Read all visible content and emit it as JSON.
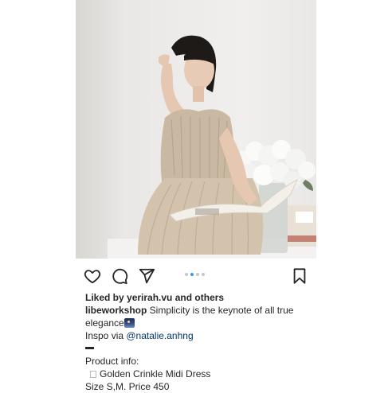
{
  "post": {
    "image_alt": "",
    "carousel": {
      "count": 4,
      "active_index": 1
    }
  },
  "actions": {
    "like_icon": "heart-icon",
    "comment_icon": "comment-icon",
    "share_icon": "send-icon",
    "save_icon": "bookmark-icon"
  },
  "likes": {
    "prefix": "Liked by ",
    "user": "yerirah.vu",
    "joiner": " and ",
    "others": "others"
  },
  "caption": {
    "username": "libeworkshop",
    "text_line1": " Simplicity is the keynote of all true",
    "text_line2": "elegance",
    "inspo_prefix": "Inspo via ",
    "inspo_mention": "@natalie.anhng",
    "product_info": "Product info:",
    "product_name": "Golden Crinkle Midi Dress",
    "size_price": "Size S,M. Price 450"
  },
  "colors": {
    "text": "#262626",
    "mention": "#00376b",
    "dot_active": "#3897f0",
    "dot_inactive": "#c7c7c7"
  }
}
